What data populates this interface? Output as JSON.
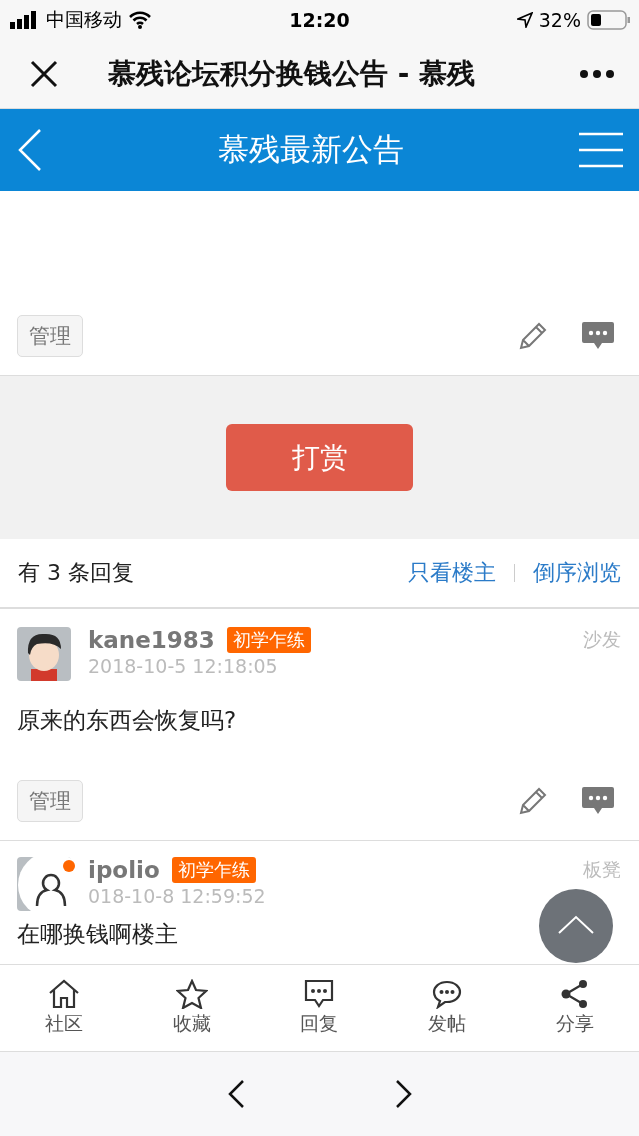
{
  "status_bar": {
    "carrier": "中国移动",
    "time": "12:20",
    "battery": "32%"
  },
  "browser_bar": {
    "title": "慕残论坛积分换钱公告 - 慕残"
  },
  "header": {
    "title": "慕残最新公告"
  },
  "thread_actions": {
    "manage": "管理"
  },
  "reward": {
    "label": "打赏"
  },
  "replies_bar": {
    "count": "有 3 条回复",
    "filters": [
      {
        "label": "只看楼主"
      },
      {
        "label": "倒序浏览"
      }
    ]
  },
  "posts": [
    {
      "username": "kane1983",
      "badge": "初学乍练",
      "time": "2018-10-5 12:18:05",
      "floor": "沙发",
      "content": "原来的东西会恢复吗?",
      "manage": "管理"
    },
    {
      "username": "ipolio",
      "badge": "初学乍练",
      "time": "018-10-8 12:59:52",
      "floor": "板凳",
      "content": "在哪换钱啊楼主"
    }
  ],
  "tab_bar": [
    {
      "kind": "home",
      "label": "社区"
    },
    {
      "kind": "star",
      "label": "收藏"
    },
    {
      "kind": "reply",
      "label": "回复"
    },
    {
      "kind": "chat",
      "label": "发帖"
    },
    {
      "kind": "share",
      "label": "分享"
    }
  ]
}
